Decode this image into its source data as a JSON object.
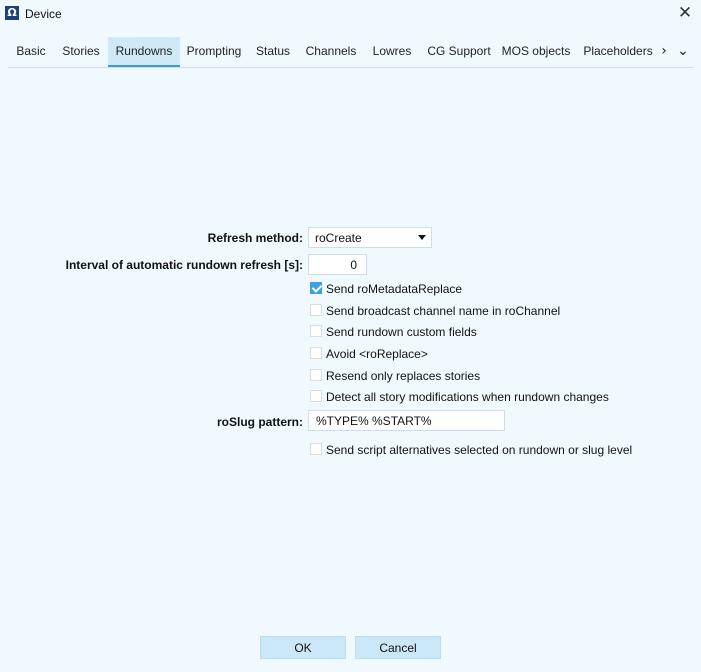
{
  "window": {
    "title": "Device",
    "app_icon": "Ω",
    "close_glyph": "✕"
  },
  "tabs": [
    {
      "label": "Basic"
    },
    {
      "label": "Stories"
    },
    {
      "label": "Rundowns",
      "active": true
    },
    {
      "label": "Prompting"
    },
    {
      "label": "Status"
    },
    {
      "label": "Channels"
    },
    {
      "label": "Lowres"
    },
    {
      "label": "CG Support"
    },
    {
      "label": "MOS objects"
    },
    {
      "label": "Placeholders"
    }
  ],
  "tab_nav": {
    "next": "›",
    "more": "⌄"
  },
  "form": {
    "refresh_method_label": "Refresh method:",
    "refresh_method_value": "roCreate",
    "interval_label": "Interval of automatic rundown refresh [s]:",
    "interval_value": "0",
    "checkboxes": [
      {
        "label": "Send roMetadataReplace",
        "checked": true
      },
      {
        "label": "Send broadcast channel name in roChannel",
        "checked": false
      },
      {
        "label": "Send rundown custom fields",
        "checked": false
      },
      {
        "label": "Avoid <roReplace>",
        "checked": false
      },
      {
        "label": "Resend only replaces stories",
        "checked": false
      },
      {
        "label": "Detect all story modifications when rundown changes",
        "checked": false
      }
    ],
    "roslug_label": "roSlug pattern:",
    "roslug_value": "%TYPE% %START%",
    "script_alt_label": "Send script alternatives selected on rundown or slug level",
    "script_alt_checked": false
  },
  "buttons": {
    "ok": "OK",
    "cancel": "Cancel"
  },
  "colors": {
    "background": "#f0fafe",
    "accent": "#3ba1e0",
    "active_tab": "#cfe9f8",
    "button": "#cbe8f8"
  }
}
